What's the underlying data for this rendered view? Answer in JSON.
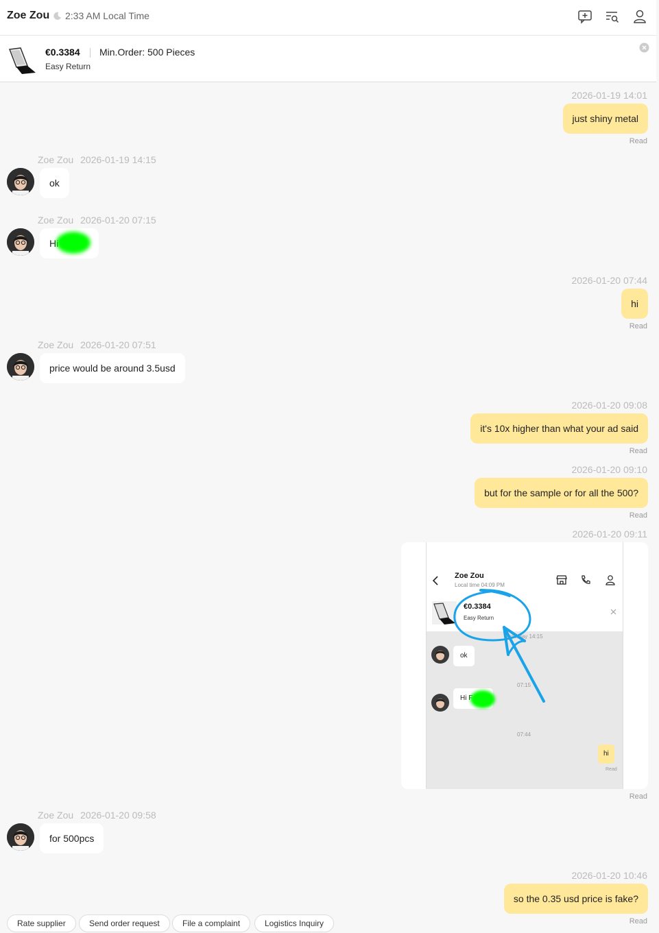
{
  "header": {
    "contact_name": "Zoe Zou",
    "local_time": "2:33 AM Local Time",
    "icons": [
      "add-message-icon",
      "search-list-icon",
      "profile-icon"
    ]
  },
  "product": {
    "price": "€0.3384",
    "min_order": "Min.Order: 500 Pieces",
    "return_policy": "Easy Return"
  },
  "messages": [
    {
      "from": "me",
      "time": "2026-01-19 14:01",
      "text": "just shiny metal",
      "status": "Read"
    },
    {
      "from": "them",
      "name": "Zoe Zou",
      "time": "2026-01-19 14:15",
      "text": "ok"
    },
    {
      "from": "them",
      "name": "Zoe Zou",
      "time": "2026-01-20 07:15",
      "text": "Hi"
    },
    {
      "from": "me",
      "time": "2026-01-20 07:44",
      "text": "hi",
      "status": "Read"
    },
    {
      "from": "them",
      "name": "Zoe Zou",
      "time": "2026-01-20 07:51",
      "text": "price would be around 3.5usd"
    },
    {
      "from": "me",
      "time": "2026-01-20 09:08",
      "text": "it's 10x higher than what your ad said",
      "status": "Read"
    },
    {
      "from": "me",
      "time": "2026-01-20 09:10",
      "text": "but for the sample or for all the 500?",
      "status": "Read"
    },
    {
      "from": "me",
      "time": "2026-01-20 09:11",
      "type": "image",
      "status": "Read"
    },
    {
      "from": "them",
      "name": "Zoe Zou",
      "time": "2026-01-20 09:58",
      "text": "for 500pcs"
    },
    {
      "from": "me",
      "time": "2026-01-20 10:46",
      "text": "so the 0.35 usd price is fake?",
      "status": "Read"
    }
  ],
  "screenshot": {
    "name": "Zoe Zou",
    "local_time": "Local time 04:09 PM",
    "price": "€0.3384",
    "return_policy": "Easy Return",
    "time1": "Yesterday 14:15",
    "msg_ok": "ok",
    "time2": "07:15",
    "msg_hi": "Hi F",
    "time3": "07:44",
    "msg_hi_me": "hi",
    "read": "Read"
  },
  "actions": [
    "Rate supplier",
    "Send order request",
    "File a complaint",
    "Logistics Inquiry"
  ],
  "colors": {
    "my_bubble": "#ffe89a",
    "their_bubble": "#ffffff",
    "annotation": "#1aa3e8",
    "redaction": "#00ff00"
  }
}
